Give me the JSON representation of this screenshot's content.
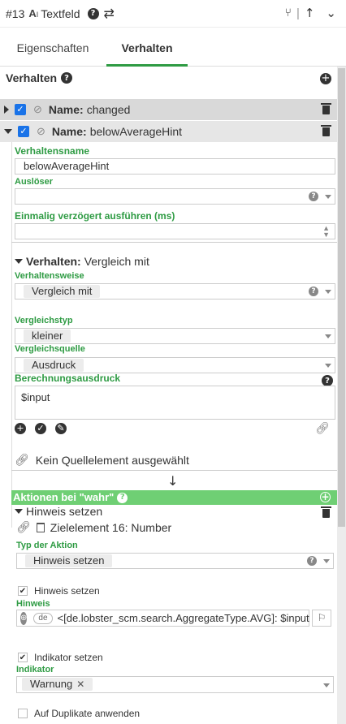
{
  "header": {
    "number": "#13",
    "type_icon": "text-field-icon",
    "title": "Textfeld",
    "right_icons": [
      "branch-icon",
      "arrow-up-icon",
      "chevron-down-icon"
    ]
  },
  "tabs": [
    {
      "label": "Eigenschaften",
      "active": false
    },
    {
      "label": "Verhalten",
      "active": true
    }
  ],
  "section": {
    "title": "Verhalten"
  },
  "behaviors": [
    {
      "name_label": "Name:",
      "name": "changed",
      "expanded": false,
      "checked": true
    },
    {
      "name_label": "Name:",
      "name": "belowAverageHint",
      "expanded": true,
      "checked": true
    }
  ],
  "form": {
    "behavior_name_label": "Verhaltensname",
    "behavior_name_value": "belowAverageHint",
    "trigger_label": "Auslöser",
    "trigger_value": "",
    "delay_label": "Einmalig verzögert ausführen (ms)",
    "delay_value": "",
    "behavior_type_head_bold": "Verhalten:",
    "behavior_type_head": "Vergleich mit",
    "mode_label": "Verhaltensweise",
    "mode_value": "Vergleich mit",
    "compare_type_label": "Vergleichstyp",
    "compare_type_value": "kleiner",
    "compare_source_label": "Vergleichsquelle",
    "compare_source_value": "Ausdruck",
    "expression_label": "Berechnungsausdruck",
    "expression_value": "$input",
    "source_element_text": "Kein Quellelement ausgewählt",
    "down_arrow": "↓"
  },
  "actions": {
    "bar_title": "Aktionen bei \"wahr\"",
    "action_title": "Hinweis setzen",
    "target_text": "Zielelement 16: Number",
    "action_type_label": "Typ der Aktion",
    "action_type_value": "Hinweis setzen",
    "set_hint_label": "Hinweis setzen",
    "hint_label": "Hinweis",
    "hint_lang": "de",
    "hint_value": "<[de.lobster_scm.search.AggregateType.AVG]: $input",
    "set_indicator_label": "Indikator setzen",
    "indicator_label": "Indikator",
    "indicator_value": "Warnung",
    "duplicates_label": "Auf Duplikate anwenden"
  },
  "colors": {
    "accent_green": "#2e9b43",
    "bar_green": "#6fcf74",
    "checkbox_blue": "#1a73e8"
  }
}
